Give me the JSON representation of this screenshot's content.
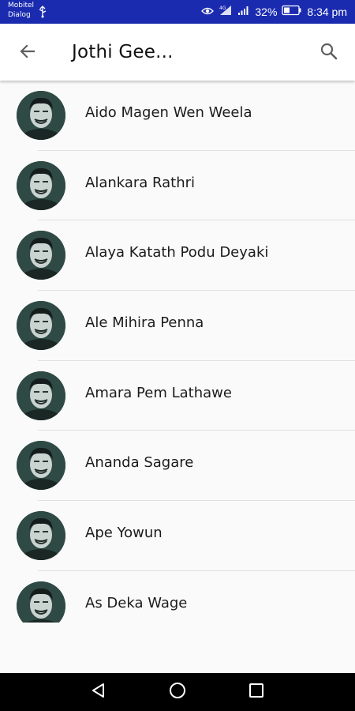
{
  "status_bar": {
    "carrier_line1": "Mobitel",
    "carrier_line2": "Dialog",
    "battery": "32%",
    "time": "8:34 pm",
    "icons": [
      "usb-icon",
      "eye-icon",
      "signal-4g-icon",
      "signal-icon",
      "battery-icon"
    ]
  },
  "app_bar": {
    "title": "Jothi Gee...",
    "back_icon": "arrow-back-icon",
    "search_icon": "search-icon"
  },
  "songs": [
    {
      "title": "Aido Magen Wen Weela"
    },
    {
      "title": "Alankara Rathri"
    },
    {
      "title": "Alaya Katath Podu Deyaki"
    },
    {
      "title": "Ale Mihira Penna"
    },
    {
      "title": "Amara Pem Lathawe"
    },
    {
      "title": "Ananda Sagare"
    },
    {
      "title": "Ape Yowun"
    },
    {
      "title": "As Deka Wage"
    }
  ],
  "nav_bar": {
    "icons": [
      "back-triangle-icon",
      "home-circle-icon",
      "recents-square-icon"
    ]
  },
  "colors": {
    "status_bar_bg": "#1a2bb0",
    "app_bar_bg": "#ffffff",
    "list_bg": "#fafafa",
    "nav_bar_bg": "#000000"
  }
}
